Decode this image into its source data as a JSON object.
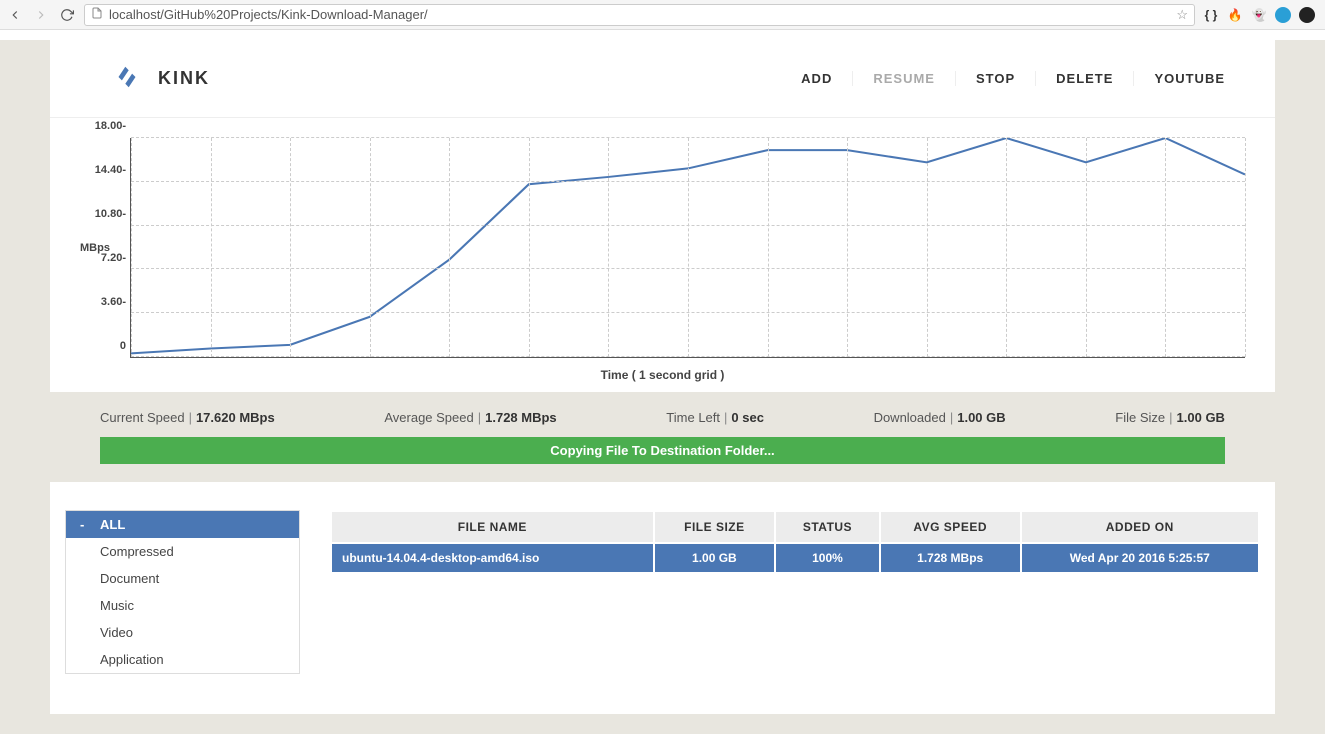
{
  "browser": {
    "url": "localhost/GitHub%20Projects/Kink-Download-Manager/"
  },
  "header": {
    "brand": "KINK",
    "nav": {
      "add": "ADD",
      "resume": "RESUME",
      "stop": "STOP",
      "delete": "DELETE",
      "youtube": "YOUTUBE"
    }
  },
  "chart_data": {
    "type": "line",
    "ylabel": "MBps",
    "xlabel": "Time ( 1 second grid )",
    "ylim": [
      0,
      18.0
    ],
    "yticks": [
      "0",
      "3.60",
      "7.20",
      "10.80",
      "14.40",
      "18.00"
    ],
    "x": [
      0,
      1,
      2,
      3,
      4,
      5,
      6,
      7,
      8,
      9,
      10,
      11,
      12,
      13,
      14
    ],
    "values": [
      0.3,
      0.7,
      1.0,
      3.3,
      8.0,
      14.2,
      14.8,
      15.5,
      17.0,
      17.0,
      16.0,
      18.0,
      16.0,
      18.0,
      15.0
    ]
  },
  "stats": {
    "current_speed": {
      "label": "Current Speed",
      "value": "17.620 MBps"
    },
    "avg_speed": {
      "label": "Average Speed",
      "value": "1.728 MBps"
    },
    "time_left": {
      "label": "Time Left",
      "value": "0 sec"
    },
    "downloaded": {
      "label": "Downloaded",
      "value": "1.00 GB"
    },
    "file_size": {
      "label": "File Size",
      "value": "1.00 GB"
    }
  },
  "status_banner": "Copying File To Destination Folder...",
  "sidebar": {
    "items": [
      {
        "label": "ALL",
        "active": true
      },
      {
        "label": "Compressed"
      },
      {
        "label": "Document"
      },
      {
        "label": "Music"
      },
      {
        "label": "Video"
      },
      {
        "label": "Application"
      }
    ]
  },
  "table": {
    "columns": [
      "FILE NAME",
      "FILE SIZE",
      "STATUS",
      "AVG SPEED",
      "ADDED ON"
    ],
    "rows": [
      {
        "file_name": "ubuntu-14.04.4-desktop-amd64.iso",
        "file_size": "1.00 GB",
        "status": "100%",
        "avg_speed": "1.728 MBps",
        "added_on": "Wed Apr 20 2016 5:25:57"
      }
    ]
  }
}
